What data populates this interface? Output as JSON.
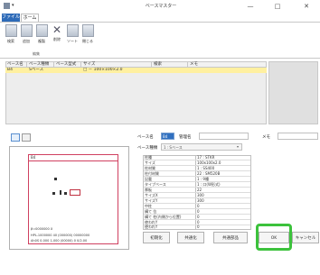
{
  "window": {
    "title": "ベースマスター",
    "qat": "▾",
    "controls": {
      "minimize": "—",
      "maximize": "□",
      "close": "✕"
    }
  },
  "ribbon": {
    "tabs": [
      "ファイル",
      "ホーム"
    ],
    "buttons": [
      "検索",
      "追加",
      "複製",
      "削除",
      "ソート",
      "閉じる"
    ],
    "group_label": "編集"
  },
  "table": {
    "columns": [
      "ベース名",
      "ベース種類",
      "ベース型式",
      "サイズ",
      "検索",
      "メモ"
    ],
    "rows": [
      [
        "B4",
        "Sベース",
        "",
        "□ － 100×100×2.0",
        "",
        ""
      ]
    ]
  },
  "preview": {
    "title": "B4",
    "lines": [
      "β=0000000 X  ",
      "HPL-1000000 40 (000000) 00000000",
      "Ah0S 0-000 1-000 (00000) 0 0/2.00"
    ]
  },
  "form": {
    "name_label": "ベース名",
    "name_value": "B4",
    "manage_label": "管理名",
    "memo_label": "メモ",
    "kind_label": "ベース種類",
    "kind_value": "1 : Sベース",
    "properties": [
      {
        "key": "柱種",
        "value": "17 : STKR"
      },
      {
        "key": "サイズ",
        "value": "100x100x2.0"
      },
      {
        "key": "柱材質",
        "value": "1 : SS400"
      },
      {
        "key": "柱付材質",
        "value": "22 : SM520B"
      },
      {
        "key": "記載",
        "value": "1 : 9種"
      },
      {
        "key": "タイプベース",
        "value": "1 : 口(W形式)"
      },
      {
        "key": "厚板",
        "value": "22"
      },
      {
        "key": "サイズX",
        "value": "300"
      },
      {
        "key": "サイズY",
        "value": "300"
      },
      {
        "key": "中柱",
        "value": "0"
      },
      {
        "key": "構て 位",
        "value": "0"
      },
      {
        "key": "構て 柱(内側から位置)",
        "value": "0"
      },
      {
        "key": "使われY",
        "value": "0"
      },
      {
        "key": "使われY",
        "value": "0"
      }
    ]
  },
  "buttons": {
    "initialize": "初期化",
    "copy_all": "共通化",
    "copy_part": "共通部品",
    "ok": "OK",
    "cancel": "キャンセル"
  },
  "colors": {
    "file_tab": "#2e6bb8",
    "selected_row": "#fff0a0",
    "highlight": "#3cc23c"
  }
}
